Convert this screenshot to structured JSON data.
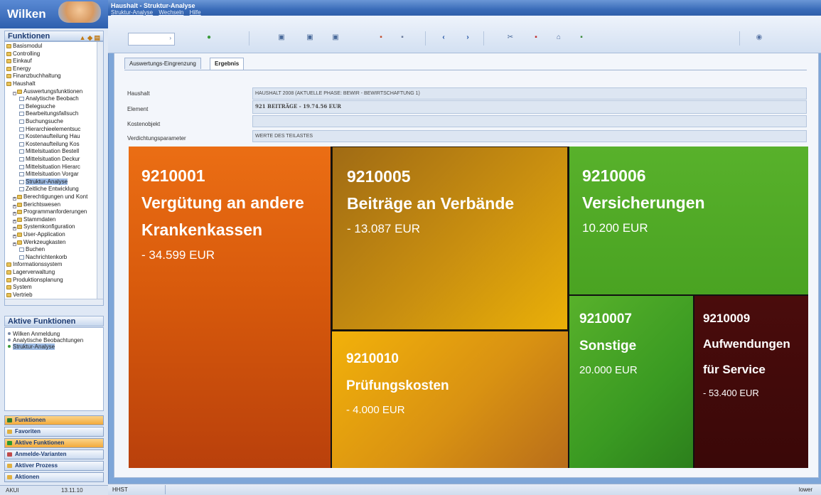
{
  "sidebar": {
    "logo": "Wilken",
    "functions_title": "Funktionen",
    "tree": [
      {
        "label": "Basismodul",
        "level": 0,
        "type": "folder"
      },
      {
        "label": "Controlling",
        "level": 0,
        "type": "folder"
      },
      {
        "label": "Einkauf",
        "level": 0,
        "type": "folder"
      },
      {
        "label": "Energy",
        "level": 0,
        "type": "folder"
      },
      {
        "label": "Finanzbuchhaltung",
        "level": 0,
        "type": "folder"
      },
      {
        "label": "Haushalt",
        "level": 0,
        "type": "folder"
      },
      {
        "label": "Auswertungsfunktionen",
        "level": 1,
        "type": "folder",
        "expander": "-"
      },
      {
        "label": "Analytische Beobach",
        "level": 2,
        "type": "doc"
      },
      {
        "label": "Belegsuche",
        "level": 2,
        "type": "doc"
      },
      {
        "label": "Bearbeitungsfallsuch",
        "level": 2,
        "type": "doc"
      },
      {
        "label": "Buchungsuche",
        "level": 2,
        "type": "doc"
      },
      {
        "label": "Hierarchieelementsuc",
        "level": 2,
        "type": "doc"
      },
      {
        "label": "Kostenaufteilung Hau",
        "level": 2,
        "type": "doc"
      },
      {
        "label": "Kostenaufteilung Kos",
        "level": 2,
        "type": "doc"
      },
      {
        "label": "Mittelsituation Bestell",
        "level": 2,
        "type": "doc"
      },
      {
        "label": "Mittelsituation Deckur",
        "level": 2,
        "type": "doc"
      },
      {
        "label": "Mittelsituation Hierarc",
        "level": 2,
        "type": "doc"
      },
      {
        "label": "Mittelsituation Vorgar",
        "level": 2,
        "type": "doc"
      },
      {
        "label": "Struktur-Analyse",
        "level": 2,
        "type": "doc",
        "selected": true
      },
      {
        "label": "Zeitliche Entwicklung",
        "level": 2,
        "type": "doc"
      },
      {
        "label": "Berechtigungen und Kont",
        "level": 1,
        "type": "folder",
        "expander": "+"
      },
      {
        "label": "Berichtswesen",
        "level": 1,
        "type": "folder",
        "expander": "+"
      },
      {
        "label": "Programmanforderungen",
        "level": 1,
        "type": "folder",
        "expander": "+"
      },
      {
        "label": "Stammdaten",
        "level": 1,
        "type": "folder",
        "expander": "+"
      },
      {
        "label": "Systemkonfiguration",
        "level": 1,
        "type": "folder",
        "expander": "+"
      },
      {
        "label": "User-Application",
        "level": 1,
        "type": "folder",
        "expander": "+"
      },
      {
        "label": "Werkzeugkasten",
        "level": 1,
        "type": "folder",
        "expander": "+"
      },
      {
        "label": "Buchen",
        "level": 2,
        "type": "doc"
      },
      {
        "label": "Nachrichtenkorb",
        "level": 2,
        "type": "doc"
      },
      {
        "label": "Informationssystem",
        "level": 0,
        "type": "folder"
      },
      {
        "label": "Lagerverwaltung",
        "level": 0,
        "type": "folder"
      },
      {
        "label": "Produktionsplanung",
        "level": 0,
        "type": "folder"
      },
      {
        "label": "System",
        "level": 0,
        "type": "folder"
      },
      {
        "label": "Vertrieb",
        "level": 0,
        "type": "folder"
      }
    ],
    "active_title": "Aktive Funktionen",
    "active_items": [
      {
        "label": "Wilken Anmeldung",
        "selected": false
      },
      {
        "label": "Analytische Beobachtungen",
        "selected": false
      },
      {
        "label": "Struktur-Analyse",
        "selected": true
      }
    ],
    "nav_buttons": [
      {
        "label": "Funktionen",
        "style": "orange",
        "icon_color": "#2d7d2d"
      },
      {
        "label": "Favoriten",
        "style": "normal",
        "icon_color": "#e0b040"
      },
      {
        "label": "Aktive Funktionen",
        "style": "orange",
        "icon_color": "#2d9a2d"
      },
      {
        "label": "Anmelde-Varianten",
        "style": "normal",
        "icon_color": "#c04a4a"
      },
      {
        "label": "Aktiver Prozess",
        "style": "normal",
        "icon_color": "#e0b040"
      },
      {
        "label": "Aktionen",
        "style": "normal",
        "icon_color": "#e0b040"
      }
    ],
    "status_left": "AKUI",
    "status_time": "13.11.10"
  },
  "window": {
    "title": "Haushalt - Struktur-Analyse",
    "menu": [
      "Struktur-Analyse",
      "Wechseln",
      "Hilfe"
    ]
  },
  "tabs": [
    "Auswertungs-Eingrenzung",
    "Ergebnis"
  ],
  "info": {
    "rows": [
      {
        "label": "Haushalt",
        "value": "HAUSHALT 2008 (AKTUELLE PHASE: BEWIR - BEWIRTSCHAFTUNG 1)"
      },
      {
        "label": "Element",
        "value": "921 BEITRÄGE  -  19.74.56 EUR"
      },
      {
        "label": "Kostenobjekt",
        "value": ""
      },
      {
        "label": "Verdichtungsparameter",
        "value": "WERTE DES TEILASTES"
      }
    ]
  },
  "treemap": [
    {
      "code": "9210001",
      "name": "Vergütung an andere Krankenkassen",
      "amount": "- 34.599 EUR"
    },
    {
      "code": "9210005",
      "name": "Beiträge an Verbände",
      "amount": "- 13.087 EUR"
    },
    {
      "code": "9210010",
      "name": "Prüfungskosten",
      "amount": "- 4.000 EUR"
    },
    {
      "code": "9210006",
      "name": "Versicherungen",
      "amount": "10.200 EUR"
    },
    {
      "code": "9210007",
      "name": "Sonstige",
      "amount": "20.000 EUR"
    },
    {
      "code": "9210009",
      "name": "Aufwendungen für Service",
      "amount": "- 53.400 EUR"
    }
  ],
  "statusbar": {
    "left": "HHST",
    "right": "lower"
  }
}
